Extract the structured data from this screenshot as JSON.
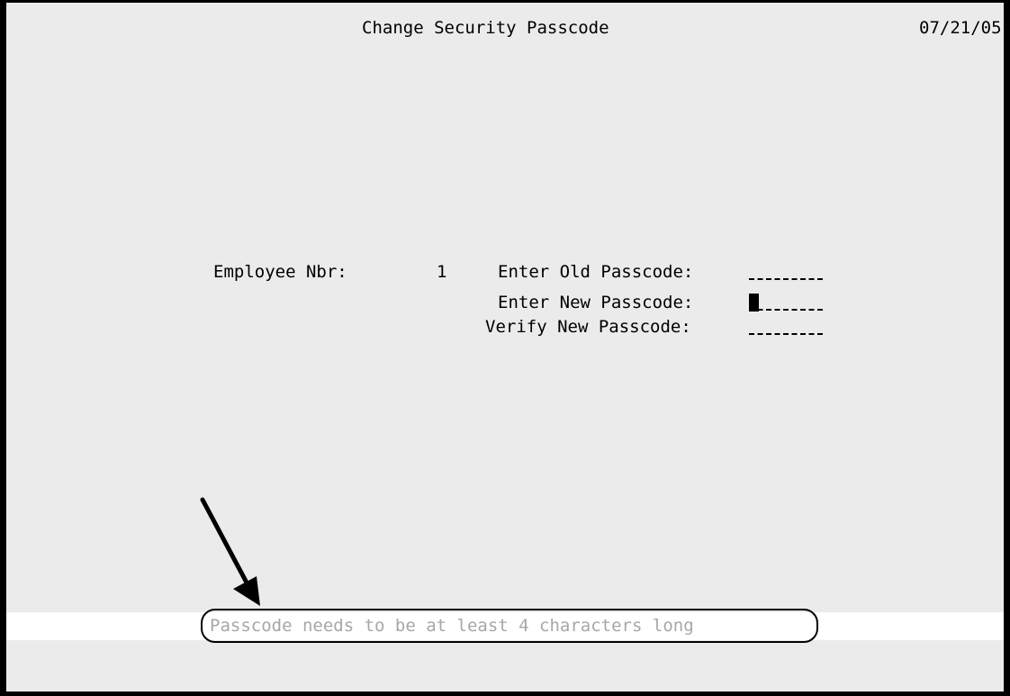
{
  "screen": {
    "title": "Change Security Passcode",
    "date": "07/21/05"
  },
  "form": {
    "employee_label": "Employee Nbr:",
    "employee_value": "1",
    "old_passcode_label": "Enter Old Passcode:",
    "new_passcode_label": "Enter New Passcode:",
    "verify_passcode_label": "Verify New Passcode:",
    "old_passcode_value": "",
    "new_passcode_value": "",
    "verify_passcode_value": ""
  },
  "status": {
    "message": "Passcode needs to be at least 4 characters long"
  },
  "annotation": {
    "arrow_icon": "arrow-down-right-icon",
    "highlight": "callout-oval"
  },
  "colors": {
    "screen_background": "#ebebeb",
    "status_bar_background": "#ffffff",
    "status_text": "#a7a7a7",
    "text": "#000000"
  }
}
